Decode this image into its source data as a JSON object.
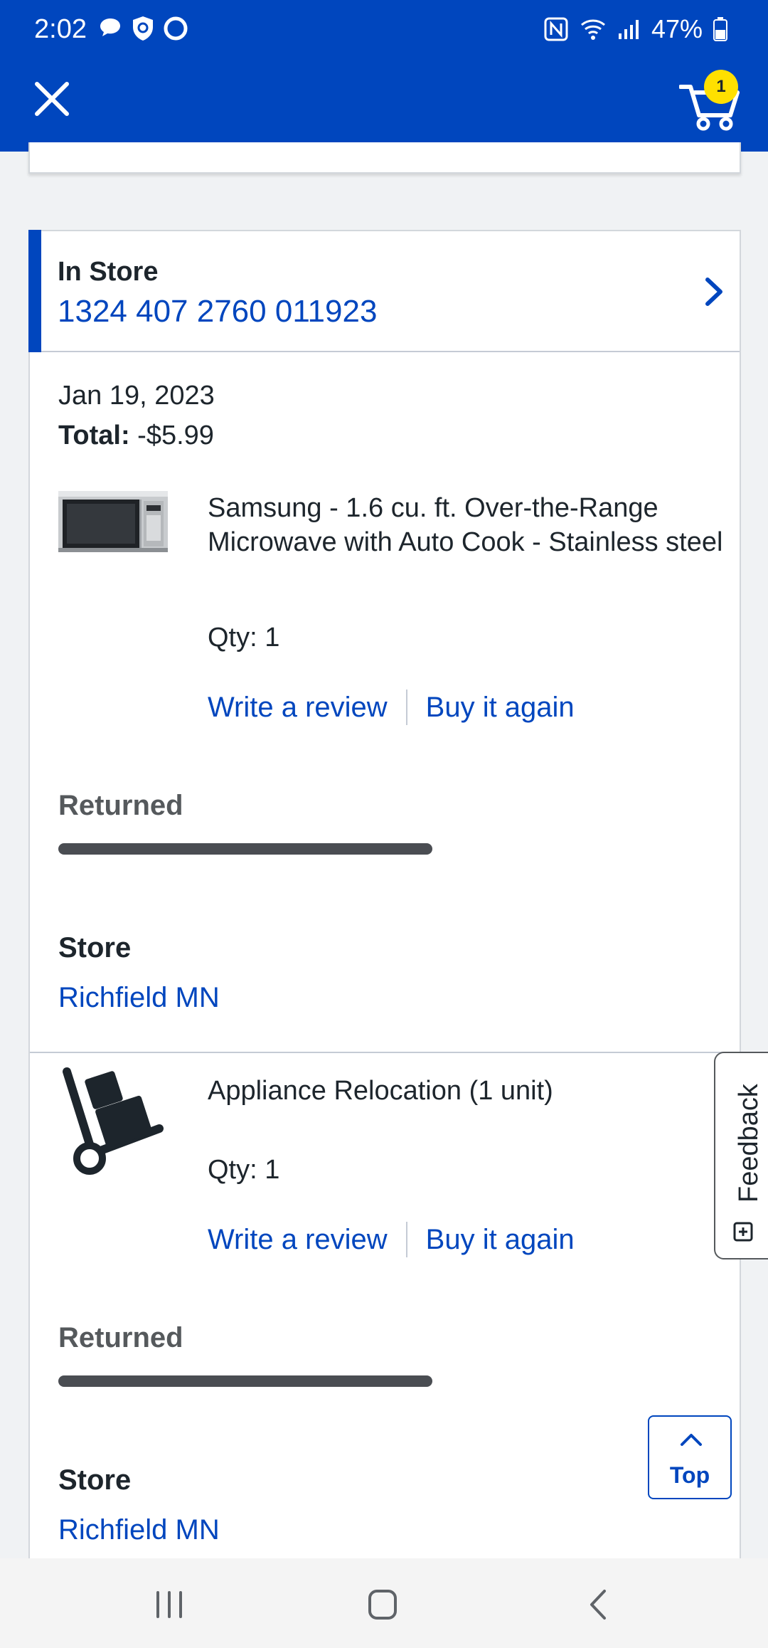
{
  "status_bar": {
    "time": "2:02",
    "battery": "47%"
  },
  "app_bar": {
    "cart_count": "1"
  },
  "order": {
    "type": "In Store",
    "number": "1324 407 2760 011923",
    "date": "Jan 19, 2023",
    "total_label": "Total:",
    "total_value": "-$5.99",
    "items": [
      {
        "name": "Samsung - 1.6 cu. ft. Over-the-Range Microwave with Auto Cook - Stainless steel",
        "qty": "Qty: 1",
        "write_review": "Write a review",
        "buy_again": "Buy it again",
        "status": "Returned",
        "store_label": "Store",
        "store_name": "Richfield MN"
      },
      {
        "name": "Appliance Relocation (1 unit)",
        "qty": "Qty: 1",
        "write_review": "Write a review",
        "buy_again": "Buy it again",
        "status": "Returned",
        "store_label": "Store",
        "store_name": "Richfield MN"
      }
    ]
  },
  "feedback": {
    "label": "Feedback"
  },
  "top_button": {
    "label": "Top"
  },
  "colors": {
    "brand_blue": "#0046be",
    "badge_yellow": "#ffe000",
    "progress_gray": "#4a4d52"
  }
}
